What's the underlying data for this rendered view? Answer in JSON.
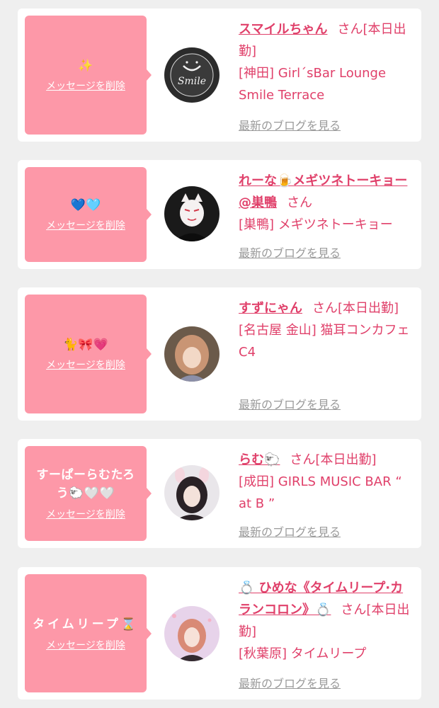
{
  "delete_label": "メッセージを削除",
  "blog_label": "最新のブログを見る",
  "honorific": "さん",
  "colors": {
    "background": "#efefef",
    "message_box": "#fd98a8",
    "name_accent": "#e0406a",
    "blog_link": "#9a9a9a"
  },
  "cards": [
    {
      "message": "✨",
      "name": "スマイルちゃん",
      "status": "[本日出勤]",
      "shop": "[神田] Girl´sBar Lounge Smile Terrace",
      "avatar_logo": "Smile"
    },
    {
      "message": "💙🩵",
      "name": "れーな🍺メギツネトーキョー@巣鴨",
      "status": "",
      "shop": "[巣鴨] メギツネトーキョー"
    },
    {
      "message": "🐈🎀💗",
      "name": "すずにゃん",
      "status": "[本日出勤]",
      "shop": "[名古屋 金山] 猫耳コンカフェ C4"
    },
    {
      "message": "すーぱーらむたろう🐑🤍🤍",
      "name": "らむ🐑",
      "status": "[本日出勤]",
      "shop": "[成田] GIRLS MUSIC BAR “ at B ”"
    },
    {
      "message": "タイムリープ⌛",
      "name": "💍 ひめな《タイムリープ·カランコロン》💍",
      "status": "[本日出勤]",
      "shop": "[秋葉原] タイムリープ"
    }
  ]
}
